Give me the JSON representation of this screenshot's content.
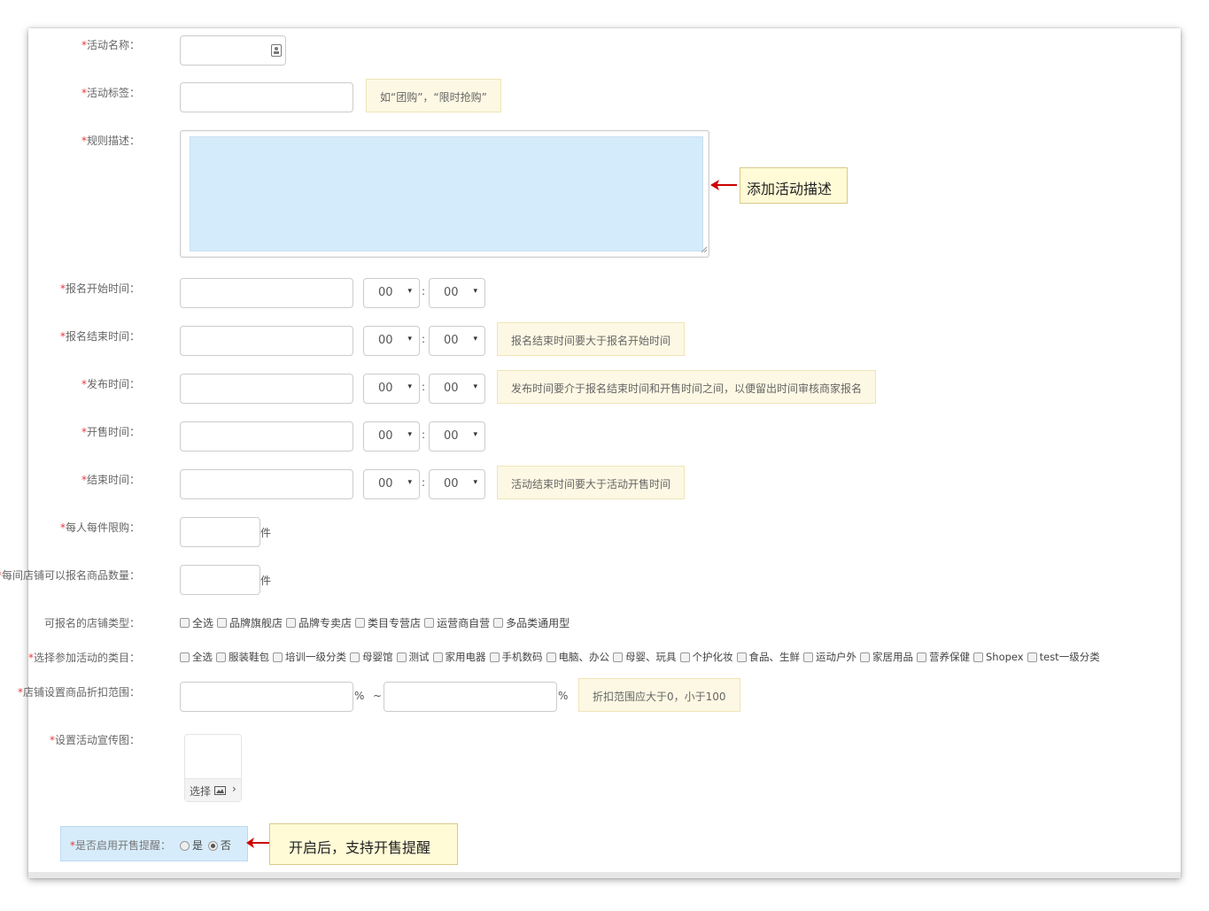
{
  "required_mark": "*",
  "fields": {
    "activity_name": {
      "label": "活动名称："
    },
    "activity_tag": {
      "label": "活动标签：",
      "hint": "如“团购”，“限时抢购”"
    },
    "rule_desc": {
      "label": "规则描述：",
      "callout": "添加活动描述"
    },
    "signup_start": {
      "label": "报名开始时间：",
      "hour": "00",
      "minute": "00"
    },
    "signup_end": {
      "label": "报名结束时间：",
      "hour": "00",
      "minute": "00",
      "hint": "报名结束时间要大于报名开始时间"
    },
    "publish_time": {
      "label": "发布时间：",
      "hour": "00",
      "minute": "00",
      "hint": "发布时间要介于报名结束时间和开售时间之间，以便留出时间审核商家报名"
    },
    "sale_start": {
      "label": "开售时间：",
      "hour": "00",
      "minute": "00"
    },
    "end_time": {
      "label": "结束时间：",
      "hour": "00",
      "minute": "00",
      "hint": "活动结束时间要大于活动开售时间"
    },
    "per_person_limit": {
      "label": "每人每件限购：",
      "unit": "件"
    },
    "per_store_count": {
      "label": "每间店铺可以报名商品数量：",
      "unit": "件"
    },
    "store_types": {
      "label": "可报名的店铺类型：",
      "options": [
        "全选",
        "品牌旗舰店",
        "品牌专卖店",
        "类目专营店",
        "运营商自营",
        "多品类通用型"
      ]
    },
    "categories": {
      "label": "选择参加活动的类目：",
      "options": [
        "全选",
        "服装鞋包",
        "培训一级分类",
        "母婴馆",
        "测试",
        "家用电器",
        "手机数码",
        "电脑、办公",
        "母婴、玩具",
        "个护化妆",
        "食品、生鲜",
        "运动户外",
        "家居用品",
        "营养保健",
        "Shopex",
        "test一级分类"
      ]
    },
    "discount_range": {
      "label": "店铺设置商品折扣范围：",
      "percent": "%",
      "tilde": "~",
      "hint": "折扣范围应大于0，小于100"
    },
    "promo_image": {
      "label": "设置活动宣传图：",
      "button": "选择",
      "chevron": "›"
    },
    "sale_reminder": {
      "label": "是否启用开售提醒：",
      "yes": "是",
      "no": "否",
      "selected": "否",
      "callout": "开启后，支持开售提醒"
    }
  },
  "time_colon": ":",
  "icons": {
    "name_field_icon": "contact-card-icon",
    "select_arrow": "▾",
    "image_icon": "image-icon",
    "callout_arrow": "red-arrow-left-icon"
  },
  "colors": {
    "required": "#e4393c",
    "hint_bg": "#fcf8e3",
    "callout_bg": "#fffbd6",
    "textarea_fill": "#d4ebfb",
    "arrow": "#cc0000"
  }
}
